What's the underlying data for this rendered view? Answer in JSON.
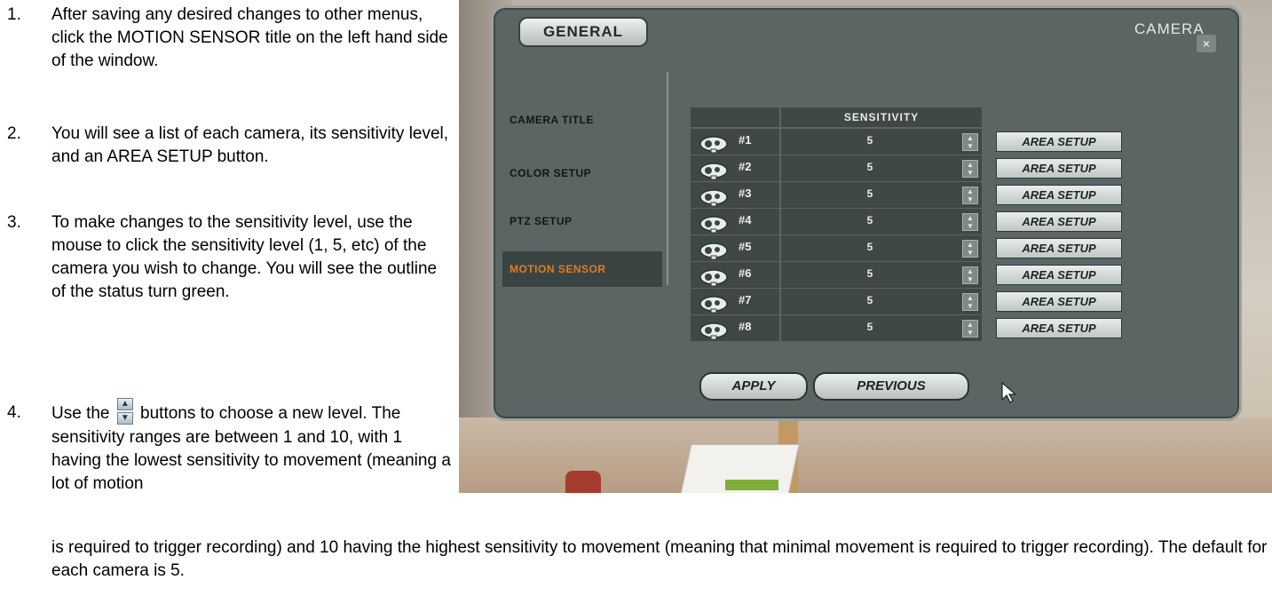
{
  "instructions": {
    "steps": [
      {
        "num": "1.",
        "text": "After saving any desired changes to other menus, click the MOTION SENSOR title on the left hand side of the window."
      },
      {
        "num": "2.",
        "text": "You will see a list of each camera, its sensitivity level, and an AREA SETUP button."
      },
      {
        "num": "3.",
        "text": "To make changes to the sensitivity level, use the mouse to click the sensitivity level (1, 5, etc) of the camera you wish to change.  You will see the outline of the status turn green."
      },
      {
        "num": "4.",
        "text_before": "Use the",
        "text_after": "buttons to choose a new level. The sensitivity ranges are between 1 and 10, with 1 having the lowest sensitivity to movement (meaning a lot of motion"
      }
    ],
    "continuation": "is required to trigger recording) and 10 having the highest sensitivity to movement (meaning that minimal movement is required to trigger recording).  The default for each camera is 5."
  },
  "dvr": {
    "tab_label": "GENERAL",
    "window_title": "CAMERA",
    "close_label": "×",
    "menu": [
      "CAMERA TITLE",
      "COLOR SETUP",
      "PTZ SETUP",
      "MOTION SENSOR"
    ],
    "active_menu": "MOTION SENSOR",
    "column_header": "SENSITIVITY",
    "cameras": [
      {
        "num": "#1",
        "sensitivity": "5",
        "button": "AREA SETUP"
      },
      {
        "num": "#2",
        "sensitivity": "5",
        "button": "AREA SETUP"
      },
      {
        "num": "#3",
        "sensitivity": "5",
        "button": "AREA SETUP"
      },
      {
        "num": "#4",
        "sensitivity": "5",
        "button": "AREA SETUP"
      },
      {
        "num": "#5",
        "sensitivity": "5",
        "button": "AREA SETUP"
      },
      {
        "num": "#6",
        "sensitivity": "5",
        "button": "AREA SETUP"
      },
      {
        "num": "#7",
        "sensitivity": "5",
        "button": "AREA SETUP"
      },
      {
        "num": "#8",
        "sensitivity": "5",
        "button": "AREA SETUP"
      }
    ],
    "apply_label": "APPLY",
    "previous_label": "PREVIOUS",
    "colors": {
      "active_menu_text": "#e07a26",
      "panel": "#5b6563"
    }
  }
}
